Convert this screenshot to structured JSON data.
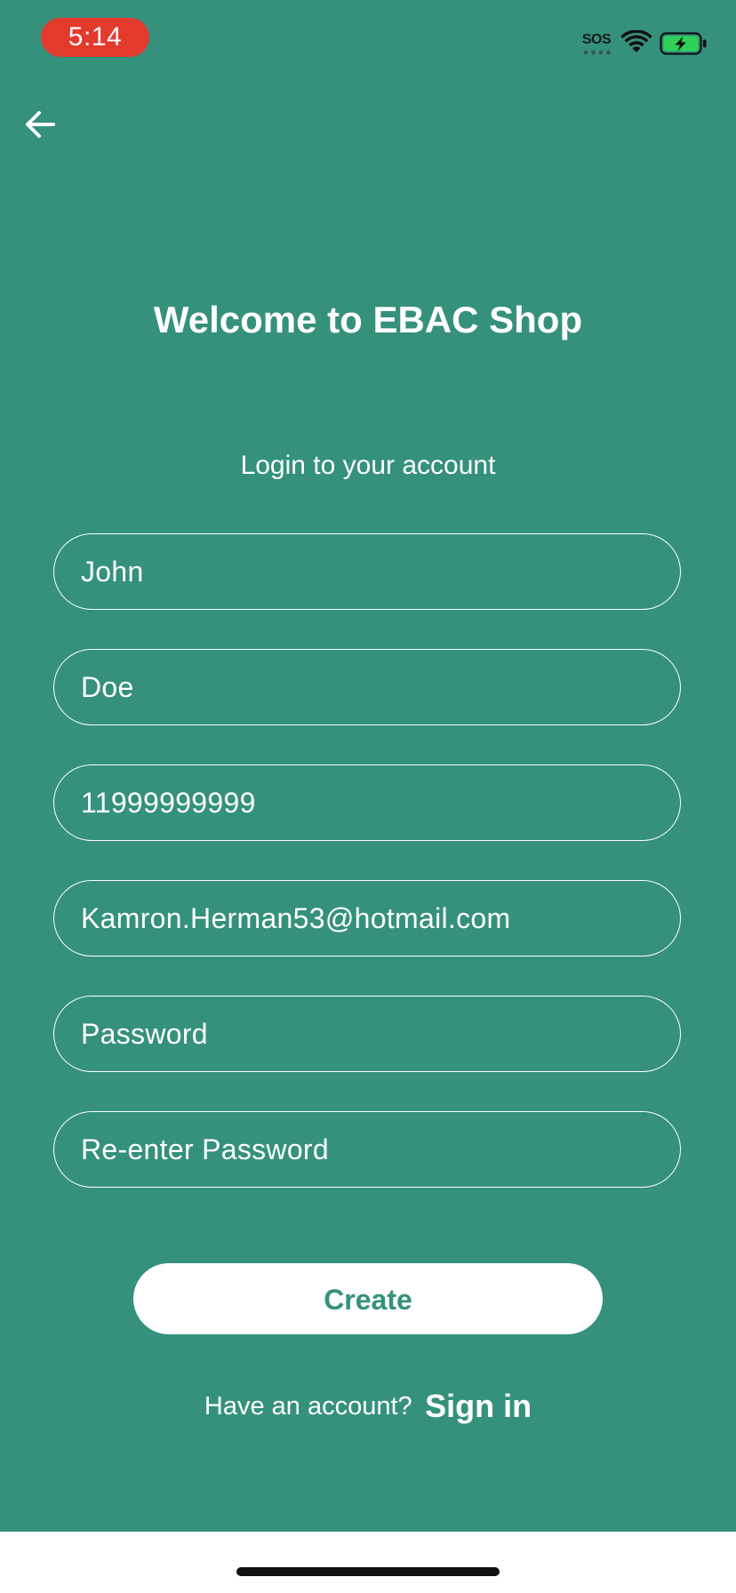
{
  "status_bar": {
    "time": "5:14",
    "sos_label": "SOS",
    "time_pill_color": "#e23a2d",
    "icons": [
      "wifi-icon",
      "battery-charging-icon"
    ]
  },
  "nav": {
    "back_icon": "arrow-left-icon"
  },
  "header": {
    "title": "Welcome to EBAC Shop",
    "subtitle": "Login to your account"
  },
  "form": {
    "first_name": {
      "value": "John",
      "placeholder": ""
    },
    "last_name": {
      "value": "Doe",
      "placeholder": ""
    },
    "phone": {
      "value": "11999999999",
      "placeholder": ""
    },
    "email": {
      "value": "Kamron.Herman53@hotmail.com",
      "placeholder": ""
    },
    "password": {
      "value": "",
      "placeholder": "Password"
    },
    "confirm_password": {
      "value": "",
      "placeholder": "Re-enter Password"
    }
  },
  "actions": {
    "create_label": "Create",
    "signin_prompt": "Have an account?",
    "signin_link": "Sign in"
  },
  "colors": {
    "background": "#35917c",
    "text": "#ffffff",
    "button_bg": "#ffffff",
    "button_text": "#35917c",
    "battery_fill": "#30d158"
  }
}
